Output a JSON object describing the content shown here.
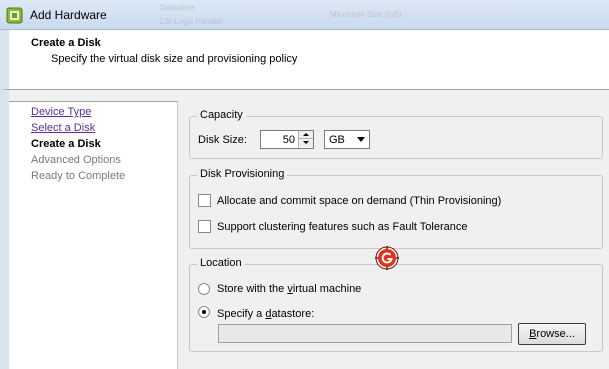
{
  "window": {
    "title": "Add Hardware",
    "ghost_left": "Datastore",
    "ghost_left2": "LSI Logic Parallel",
    "ghost_right": "Maximum Size (GB)"
  },
  "header": {
    "title": "Create a Disk",
    "subtitle": "Specify the virtual disk size and provisioning policy"
  },
  "nav": {
    "items": [
      {
        "label": "Device Type",
        "state": "link"
      },
      {
        "label": "Select a Disk",
        "state": "link"
      },
      {
        "label": "Create a Disk",
        "state": "active"
      },
      {
        "label": "Advanced Options",
        "state": "disabled"
      },
      {
        "label": "Ready to Complete",
        "state": "disabled"
      }
    ]
  },
  "capacity": {
    "group_label": "Capacity",
    "disk_size_label": "Disk Size:",
    "disk_size_value": "50",
    "unit_value": "GB"
  },
  "provisioning": {
    "group_label": "Disk Provisioning",
    "thin_label": "Allocate and commit space on demand (Thin Provisioning)",
    "thin_checked": false,
    "ft_label": "Support clustering features such as Fault Tolerance",
    "ft_checked": false
  },
  "location": {
    "group_label": "Location",
    "store_with_vm_label_pre": "Store with the ",
    "store_with_vm_label_u": "v",
    "store_with_vm_label_post": "irtual machine",
    "specify_label_pre": "Specify a ",
    "specify_label_u": "d",
    "specify_label_post": "atastore:",
    "selected": "specify",
    "datastore_value": "",
    "browse_label_u": "B",
    "browse_label_post": "rowse..."
  },
  "colors": {
    "link": "#5a2ea0",
    "disabled": "#7a7a7a",
    "badge_red": "#e0301e"
  }
}
